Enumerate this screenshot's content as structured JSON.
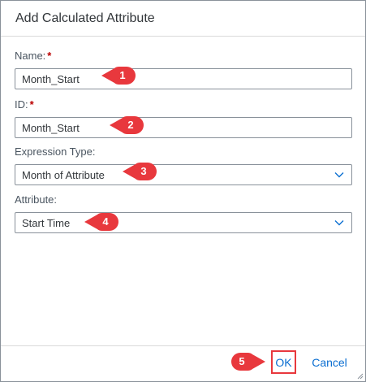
{
  "dialog": {
    "title": "Add Calculated Attribute",
    "fields": {
      "name": {
        "label": "Name:",
        "required_mark": "*",
        "value": "Month_Start",
        "callout": "1"
      },
      "id": {
        "label": "ID:",
        "required_mark": "*",
        "value": "Month_Start",
        "callout": "2"
      },
      "expression_type": {
        "label": "Expression Type:",
        "value": "Month of Attribute",
        "callout": "3"
      },
      "attribute": {
        "label": "Attribute:",
        "value": "Start Time",
        "callout": "4"
      }
    },
    "footer": {
      "ok_label": "OK",
      "cancel_label": "Cancel",
      "ok_callout": "5"
    }
  },
  "colors": {
    "accent": "#0a6ed1",
    "callout": "#e8383d",
    "required": "#bb0000"
  },
  "icons": [
    "chevron-down-icon",
    "resize-grip-icon"
  ]
}
